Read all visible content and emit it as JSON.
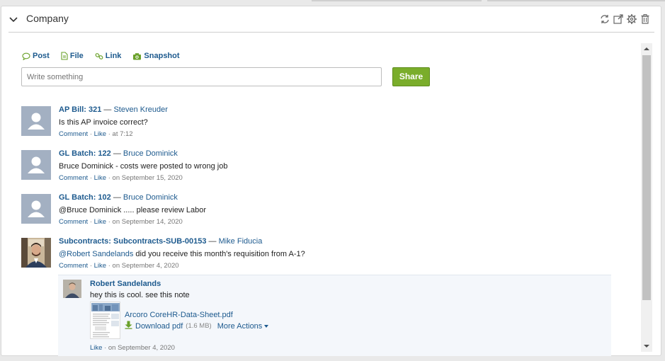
{
  "panel": {
    "title": "Company"
  },
  "composer": {
    "tabs": [
      {
        "label": "Post",
        "icon": "speech-bubble-icon"
      },
      {
        "label": "File",
        "icon": "file-icon"
      },
      {
        "label": "Link",
        "icon": "link-icon"
      },
      {
        "label": "Snapshot",
        "icon": "camera-icon"
      }
    ],
    "placeholder": "Write something",
    "share_label": "Share"
  },
  "feed": [
    {
      "ref": "AP Bill: 321",
      "sep": "—",
      "author": "Steven Kreuder",
      "text": "Is this AP invoice correct?",
      "comment": "Comment",
      "like": "Like",
      "dot": "·",
      "when": "at 7:12"
    },
    {
      "ref": "GL Batch: 122",
      "sep": "—",
      "author": "Bruce Dominick",
      "text": "Bruce Dominick - costs were posted to wrong job",
      "comment": "Comment",
      "like": "Like",
      "dot": "·",
      "when": "on September 15, 2020"
    },
    {
      "ref": "GL Batch: 102",
      "sep": "—",
      "author": "Bruce Dominick",
      "text": "@Bruce Dominick ..... please review Labor",
      "comment": "Comment",
      "like": "Like",
      "dot": "·",
      "when": "on September 14, 2020"
    },
    {
      "ref": "Subcontracts: Subcontracts-SUB-00153",
      "sep": "—",
      "author": "Mike Fiducia",
      "mention": "@Robert Sandelands",
      "text": " did you receive this month's requisition from A-1?",
      "comment": "Comment",
      "like": "Like",
      "dot": "·",
      "when": "on September 4, 2020"
    }
  ],
  "reply": {
    "name": "Robert Sandelands",
    "text": "hey this is cool. see this note",
    "file_name": "Arcoro CoreHR-Data-Sheet.pdf",
    "download": "Download pdf",
    "size": "(1.6 MB)",
    "more": "More Actions",
    "like": "Like",
    "dot": "·",
    "when": "on September 4, 2020"
  },
  "colors": {
    "link": "#1d5a8e",
    "share_green": "#7aad2b",
    "avatar_placeholder": "#a3b0c2"
  }
}
